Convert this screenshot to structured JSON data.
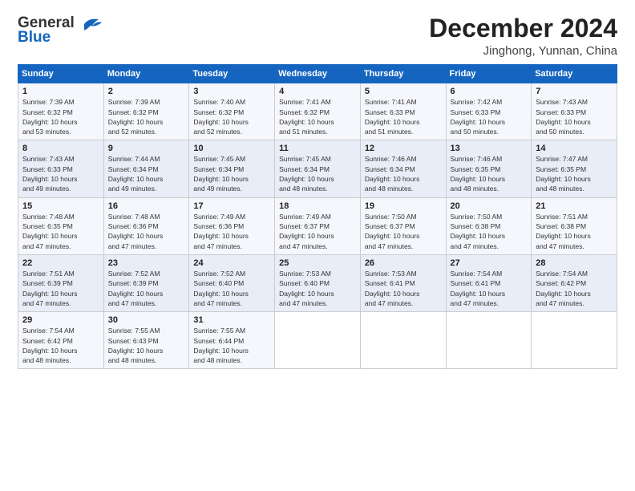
{
  "logo": {
    "line1": "General",
    "line2": "Blue"
  },
  "title": "December 2024",
  "subtitle": "Jinghong, Yunnan, China",
  "weekdays": [
    "Sunday",
    "Monday",
    "Tuesday",
    "Wednesday",
    "Thursday",
    "Friday",
    "Saturday"
  ],
  "weeks": [
    [
      {
        "day": "1",
        "sunrise": "7:39 AM",
        "sunset": "6:32 PM",
        "daylight": "10 hours and 53 minutes."
      },
      {
        "day": "2",
        "sunrise": "7:39 AM",
        "sunset": "6:32 PM",
        "daylight": "10 hours and 52 minutes."
      },
      {
        "day": "3",
        "sunrise": "7:40 AM",
        "sunset": "6:32 PM",
        "daylight": "10 hours and 52 minutes."
      },
      {
        "day": "4",
        "sunrise": "7:41 AM",
        "sunset": "6:32 PM",
        "daylight": "10 hours and 51 minutes."
      },
      {
        "day": "5",
        "sunrise": "7:41 AM",
        "sunset": "6:33 PM",
        "daylight": "10 hours and 51 minutes."
      },
      {
        "day": "6",
        "sunrise": "7:42 AM",
        "sunset": "6:33 PM",
        "daylight": "10 hours and 50 minutes."
      },
      {
        "day": "7",
        "sunrise": "7:43 AM",
        "sunset": "6:33 PM",
        "daylight": "10 hours and 50 minutes."
      }
    ],
    [
      {
        "day": "8",
        "sunrise": "7:43 AM",
        "sunset": "6:33 PM",
        "daylight": "10 hours and 49 minutes."
      },
      {
        "day": "9",
        "sunrise": "7:44 AM",
        "sunset": "6:34 PM",
        "daylight": "10 hours and 49 minutes."
      },
      {
        "day": "10",
        "sunrise": "7:45 AM",
        "sunset": "6:34 PM",
        "daylight": "10 hours and 49 minutes."
      },
      {
        "day": "11",
        "sunrise": "7:45 AM",
        "sunset": "6:34 PM",
        "daylight": "10 hours and 48 minutes."
      },
      {
        "day": "12",
        "sunrise": "7:46 AM",
        "sunset": "6:34 PM",
        "daylight": "10 hours and 48 minutes."
      },
      {
        "day": "13",
        "sunrise": "7:46 AM",
        "sunset": "6:35 PM",
        "daylight": "10 hours and 48 minutes."
      },
      {
        "day": "14",
        "sunrise": "7:47 AM",
        "sunset": "6:35 PM",
        "daylight": "10 hours and 48 minutes."
      }
    ],
    [
      {
        "day": "15",
        "sunrise": "7:48 AM",
        "sunset": "6:35 PM",
        "daylight": "10 hours and 47 minutes."
      },
      {
        "day": "16",
        "sunrise": "7:48 AM",
        "sunset": "6:36 PM",
        "daylight": "10 hours and 47 minutes."
      },
      {
        "day": "17",
        "sunrise": "7:49 AM",
        "sunset": "6:36 PM",
        "daylight": "10 hours and 47 minutes."
      },
      {
        "day": "18",
        "sunrise": "7:49 AM",
        "sunset": "6:37 PM",
        "daylight": "10 hours and 47 minutes."
      },
      {
        "day": "19",
        "sunrise": "7:50 AM",
        "sunset": "6:37 PM",
        "daylight": "10 hours and 47 minutes."
      },
      {
        "day": "20",
        "sunrise": "7:50 AM",
        "sunset": "6:38 PM",
        "daylight": "10 hours and 47 minutes."
      },
      {
        "day": "21",
        "sunrise": "7:51 AM",
        "sunset": "6:38 PM",
        "daylight": "10 hours and 47 minutes."
      }
    ],
    [
      {
        "day": "22",
        "sunrise": "7:51 AM",
        "sunset": "6:39 PM",
        "daylight": "10 hours and 47 minutes."
      },
      {
        "day": "23",
        "sunrise": "7:52 AM",
        "sunset": "6:39 PM",
        "daylight": "10 hours and 47 minutes."
      },
      {
        "day": "24",
        "sunrise": "7:52 AM",
        "sunset": "6:40 PM",
        "daylight": "10 hours and 47 minutes."
      },
      {
        "day": "25",
        "sunrise": "7:53 AM",
        "sunset": "6:40 PM",
        "daylight": "10 hours and 47 minutes."
      },
      {
        "day": "26",
        "sunrise": "7:53 AM",
        "sunset": "6:41 PM",
        "daylight": "10 hours and 47 minutes."
      },
      {
        "day": "27",
        "sunrise": "7:54 AM",
        "sunset": "6:41 PM",
        "daylight": "10 hours and 47 minutes."
      },
      {
        "day": "28",
        "sunrise": "7:54 AM",
        "sunset": "6:42 PM",
        "daylight": "10 hours and 47 minutes."
      }
    ],
    [
      {
        "day": "29",
        "sunrise": "7:54 AM",
        "sunset": "6:42 PM",
        "daylight": "10 hours and 48 minutes."
      },
      {
        "day": "30",
        "sunrise": "7:55 AM",
        "sunset": "6:43 PM",
        "daylight": "10 hours and 48 minutes."
      },
      {
        "day": "31",
        "sunrise": "7:55 AM",
        "sunset": "6:44 PM",
        "daylight": "10 hours and 48 minutes."
      },
      null,
      null,
      null,
      null
    ]
  ]
}
